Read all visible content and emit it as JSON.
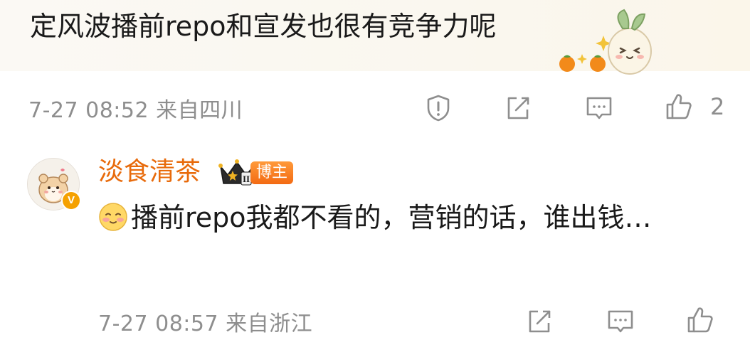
{
  "comment": {
    "text": "定风波播前repo和宣发也很有竞争力呢",
    "meta": "7-27 08:52 来自四川",
    "like_count": "2",
    "icons": [
      "report-icon",
      "share-icon",
      "comment-icon",
      "like-icon"
    ]
  },
  "reply": {
    "username": "淡食清茶",
    "verified_mark": "V",
    "badge": "博主",
    "crown_numeral": "II",
    "text": "播前repo我都不看的，营销的话，谁出钱…",
    "meta": "7-27 08:57 来自浙江",
    "icons": [
      "share-icon",
      "comment-icon",
      "like-icon"
    ]
  },
  "colors": {
    "username": "#e86b0c",
    "meta": "#8e8e8e",
    "badge": "#f36a13"
  }
}
